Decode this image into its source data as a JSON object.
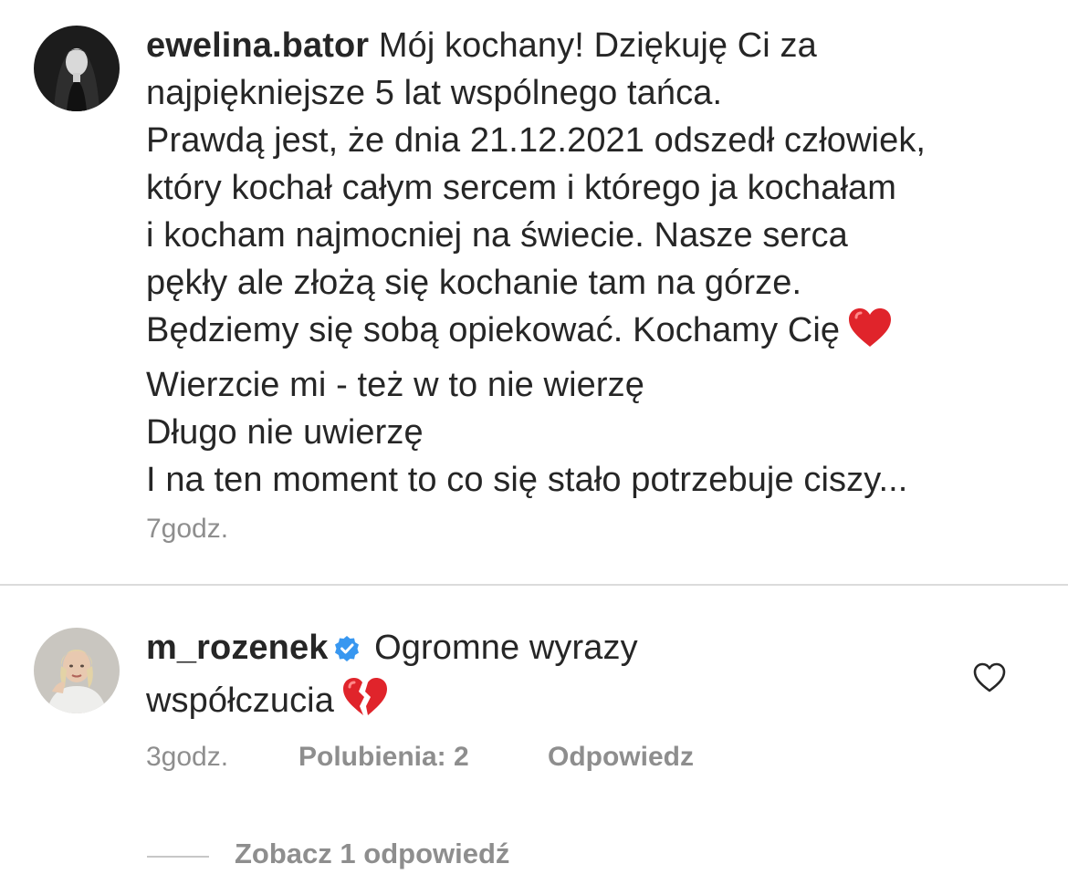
{
  "comments": [
    {
      "username": "ewelina.bator",
      "lines": [
        "Mój kochany! Dziękuję Ci za",
        "najpiękniejsze 5 lat wspólnego tańca.",
        "Prawdą jest, że dnia 21.12.2021 odszedł człowiek,",
        "który kochał całym sercem i którego ja kochałam",
        "i kocham najmocniej na świecie. Nasze serca",
        "pękły ale złożą się kochanie tam na górze.",
        "Będziemy się sobą opiekować. Kochamy Cię",
        "Wierzcie mi - też w to nie wierzę",
        "Długo nie uwierzę",
        "I na ten moment to co się stało potrzebuje ciszy..."
      ],
      "time": "7godz."
    },
    {
      "username": "m_rozenek",
      "verified": true,
      "lines": [
        "Ogromne wyrazy",
        "współczucia"
      ],
      "time": "3godz.",
      "likes": "Polubienia: 2",
      "reply": "Odpowiedz",
      "view_replies": "Zobacz 1 odpowiedź"
    }
  ],
  "icons": {
    "red_heart": "red-heart-emoji",
    "broken_heart": "broken-heart-emoji",
    "verified": "verified-badge-icon",
    "like": "heart-outline-icon"
  },
  "colors": {
    "text": "#262626",
    "muted": "#8e8e8e",
    "verified_blue": "#3897f0",
    "divider": "#dbdbdb"
  }
}
